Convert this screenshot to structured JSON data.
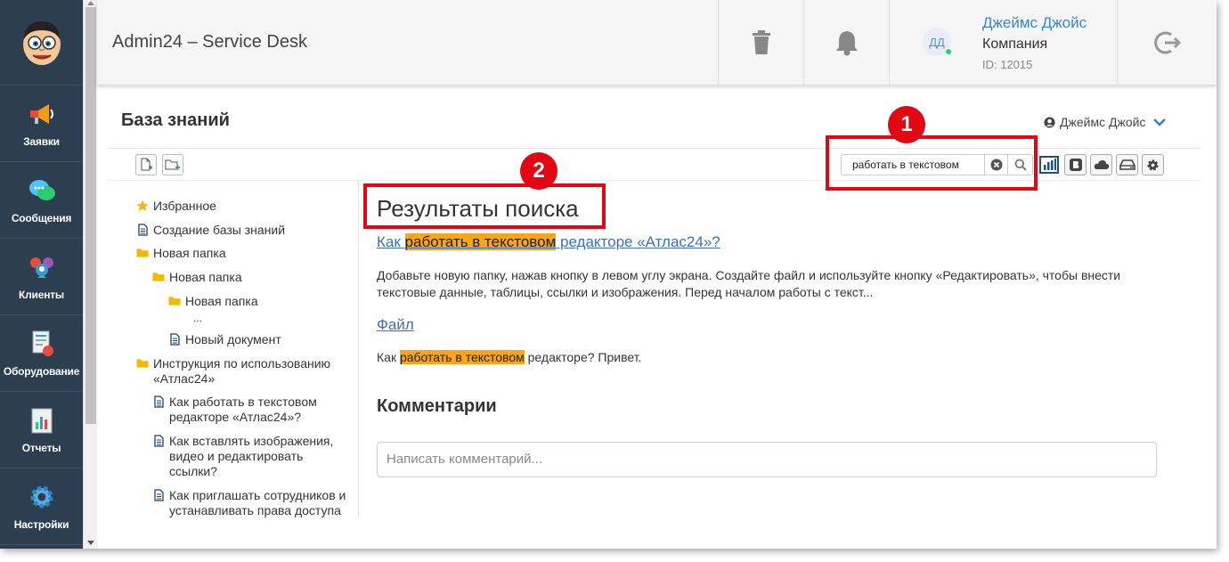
{
  "header": {
    "app_title": "Admin24 – Service Desk",
    "user": {
      "initials": "ДД",
      "name": "Джеймс Джойс",
      "company": "Компания",
      "id": "ID: 12015",
      "online_color": "#2ecc71"
    }
  },
  "sidebar": {
    "items": [
      {
        "label": "Заявки",
        "icon": "megaphone-icon"
      },
      {
        "label": "Сообщения",
        "icon": "chat-bubbles-icon"
      },
      {
        "label": "Клиенты",
        "icon": "users-hearts-icon"
      },
      {
        "label": "Оборудование",
        "icon": "equipment-icon"
      },
      {
        "label": "Отчеты",
        "icon": "report-chart-icon"
      },
      {
        "label": "Настройки",
        "icon": "gear-icon"
      }
    ]
  },
  "page": {
    "title": "База знаний",
    "current_user": "Джеймс Джойс"
  },
  "search": {
    "value": "работать в текстовом"
  },
  "callouts": [
    "1",
    "2"
  ],
  "tree": {
    "items": [
      {
        "label": "Избранное",
        "icon": "star-icon"
      },
      {
        "label": "Создание базы знаний",
        "icon": "document-icon"
      },
      {
        "label": "Новая папка",
        "icon": "folder-icon"
      },
      {
        "label": "Новая папка",
        "icon": "folder-icon"
      },
      {
        "label": "Новая папка",
        "icon": "folder-icon"
      },
      {
        "label": "...",
        "icon": ""
      },
      {
        "label": "Новый документ",
        "icon": "document-icon"
      },
      {
        "label": "Инструкция по использованию «Атлас24»",
        "icon": "folder-icon"
      },
      {
        "label": "Как работать в текстовом редакторе «Атлас24»?",
        "icon": "document-icon"
      },
      {
        "label": "Как вставлять изображения, видео и редактировать ссылки?",
        "icon": "document-icon"
      },
      {
        "label": "Как приглашать сотрудников и устанавливать права доступа",
        "icon": "document-icon"
      }
    ]
  },
  "results": {
    "title": "Результаты поиска",
    "items": [
      {
        "link_pre": "Как ",
        "link_hl": "работать в текстовом",
        "link_post": " редакторе «Атлас24»?",
        "snippet": "Добавьте новую папку, нажав кнопку в левом углу экрана. Создайте файл и используйте кнопку «Редактировать», чтобы внести текстовые данные, таблицы, ссылки и изображения. Перед началом работы с текст..."
      },
      {
        "link": "Файл",
        "snippet_pre": "Как ",
        "snippet_hl": "работать в текстовом",
        "snippet_post": " редакторе? Привет."
      }
    ]
  },
  "comments": {
    "title": "Комментарии",
    "placeholder": "Написать комментарий..."
  },
  "colors": {
    "sidebar_bg": "#2c3e50",
    "highlight": "#f9a51a",
    "callout": "#e30613",
    "link": "#3a6fc4"
  }
}
